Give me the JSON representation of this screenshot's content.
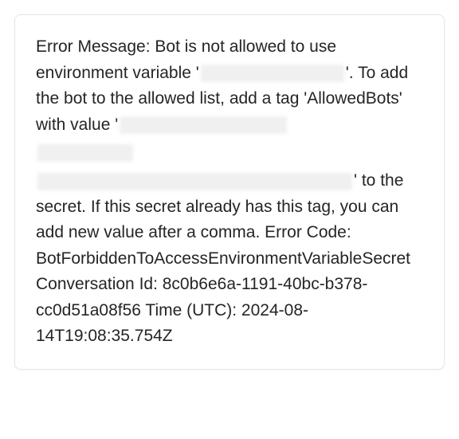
{
  "message": {
    "part1": "Error Message: Bot is not allowed to use environment variable '",
    "part2": "'. To add the bot to the allowed list, add a tag 'AllowedBots' with value '",
    "part3": "' to the secret. If this secret already has this tag, you can add new value after a comma. Error Code: BotForbiddenToAccessEnvironmentVariableSecret Conversation Id: 8c0b6e6a-1191-40bc-b378-cc0d51a08f56 Time (UTC): 2024-08-14T19:08:35.754Z"
  }
}
